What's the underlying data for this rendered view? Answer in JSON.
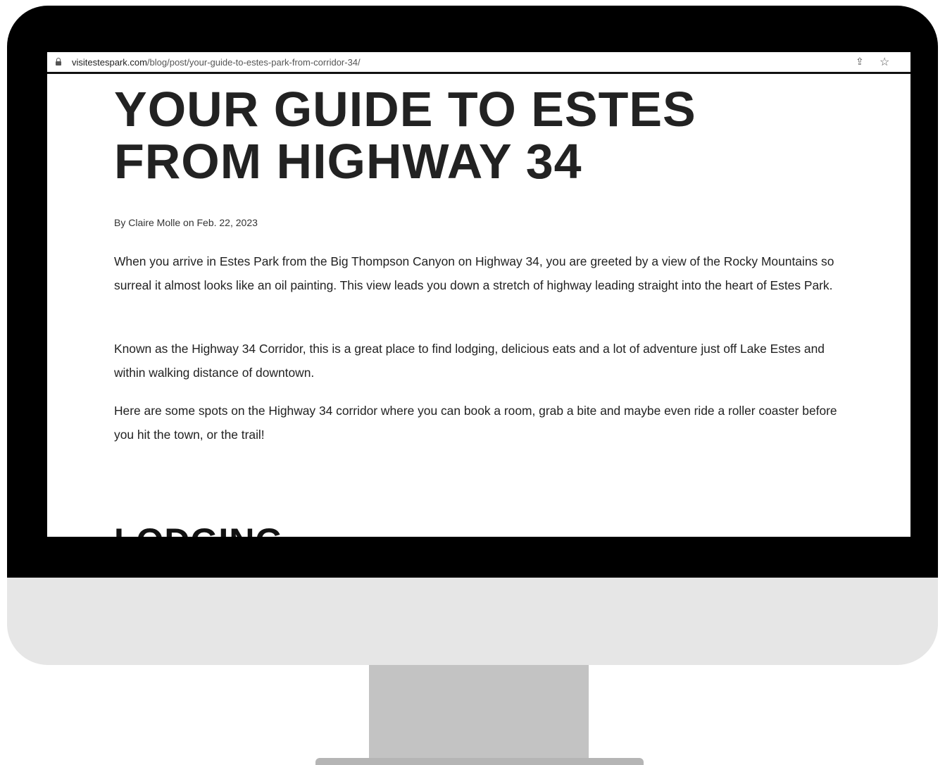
{
  "browser": {
    "url_host": "visitestespark.com",
    "url_path": "/blog/post/your-guide-to-estes-park-from-corridor-34/"
  },
  "article": {
    "title": "YOUR GUIDE TO ESTES FROM HIGHWAY 34",
    "byline": "By Claire Molle on Feb. 22, 2023",
    "paragraphs": [
      "When you arrive in Estes Park from the Big Thompson Canyon on Highway 34, you are greeted by a view of the Rocky Mountains so surreal it almost looks like an oil painting. This view leads you down a stretch of highway leading straight into the heart of Estes Park.",
      "Known as the Highway 34 Corridor, this is a great place to find lodging, delicious eats and a lot of adventure just off Lake Estes and within walking distance of downtown.",
      "Here are some spots on the Highway 34 corridor where you can book a room, grab a bite and maybe even ride a roller coaster before you hit the town, or the trail!"
    ],
    "section_heading": "LODGING"
  },
  "icons": {
    "lock": "lock-icon",
    "share": "share-icon",
    "bookmark": "star-icon"
  }
}
